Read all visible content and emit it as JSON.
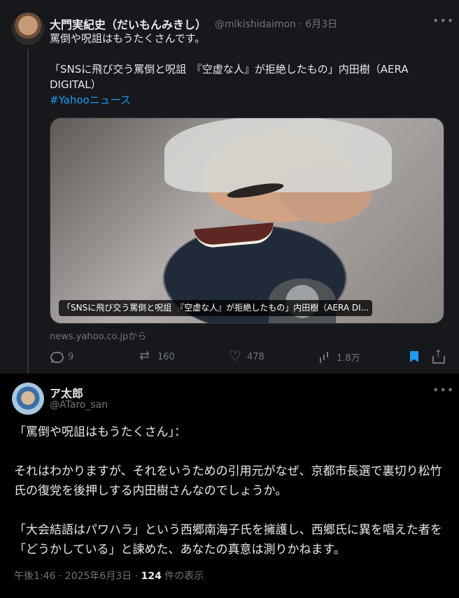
{
  "tweet1": {
    "display_name": "大門実紀史（だいもんみきし）",
    "handle_date": "@mikishidaimon · 6月3日",
    "more": "•••",
    "lines": [
      "罵倒や呪詛はもうたくさんです。",
      "「SNSに飛び交う罵倒と呪詛　『空虚な人』が拒絶したもの」内田樹（AERA DIGITAL）"
    ],
    "hashtag": "#Yahooニュース",
    "card_caption": "「SNSに飛び交う罵倒と呪詛　『空虚な人』が拒絶したもの」内田樹（AERA DI...",
    "card_source": "news.yahoo.co.jpから",
    "actions": {
      "reply": "9",
      "retweet": "160",
      "like": "478",
      "views": "1.8万"
    }
  },
  "tweet2": {
    "display_name": "ア太郎",
    "handle": "@ATaro_san",
    "more": "•••",
    "paragraphs": [
      "「罵倒や呪詛はもうたくさん」：",
      "それはわかりますが、それをいうための引用元がなぜ、京都市長選で裏切り松竹氏の復党を後押しする内田樹さんなのでしょうか。",
      "「大会結語はパワハラ」という西郷南海子氏を擁護し、西郷氏に異を唱えた者を「どうかしている」と諫めた、あなたの真意は測りかねます。"
    ],
    "footer_prefix": "午後1:46 · 2025年6月3日 · ",
    "footer_views": "124",
    "footer_suffix": " 件の表示"
  },
  "icons": {
    "reply": "reply-icon",
    "retweet": "retweet-icon",
    "like": "heart-icon",
    "views": "views-icon",
    "bookmark": "bookmark-icon",
    "share": "share-icon"
  },
  "colors": {
    "background": "#000000",
    "top_tweet_background": "#16181c",
    "text": "#e7e9ea",
    "muted": "#71767b",
    "accent": "#1d9bf0"
  }
}
